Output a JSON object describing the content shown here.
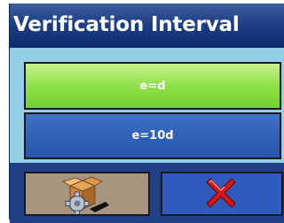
{
  "window": {
    "title": "Verification Interval"
  },
  "options": [
    {
      "label": "e=d",
      "selected": true
    },
    {
      "label": "e=10d",
      "selected": false
    }
  ],
  "softkeys": {
    "left": {
      "icon": "box-gear-icon"
    },
    "right": {
      "icon": "red-x-cancel-icon"
    }
  },
  "colors": {
    "title_bar": "#1f3f86",
    "background": "#93cde6",
    "selected_option": "#8fe04a",
    "option": "#2e60b6",
    "cancel_red": "#d81818"
  }
}
